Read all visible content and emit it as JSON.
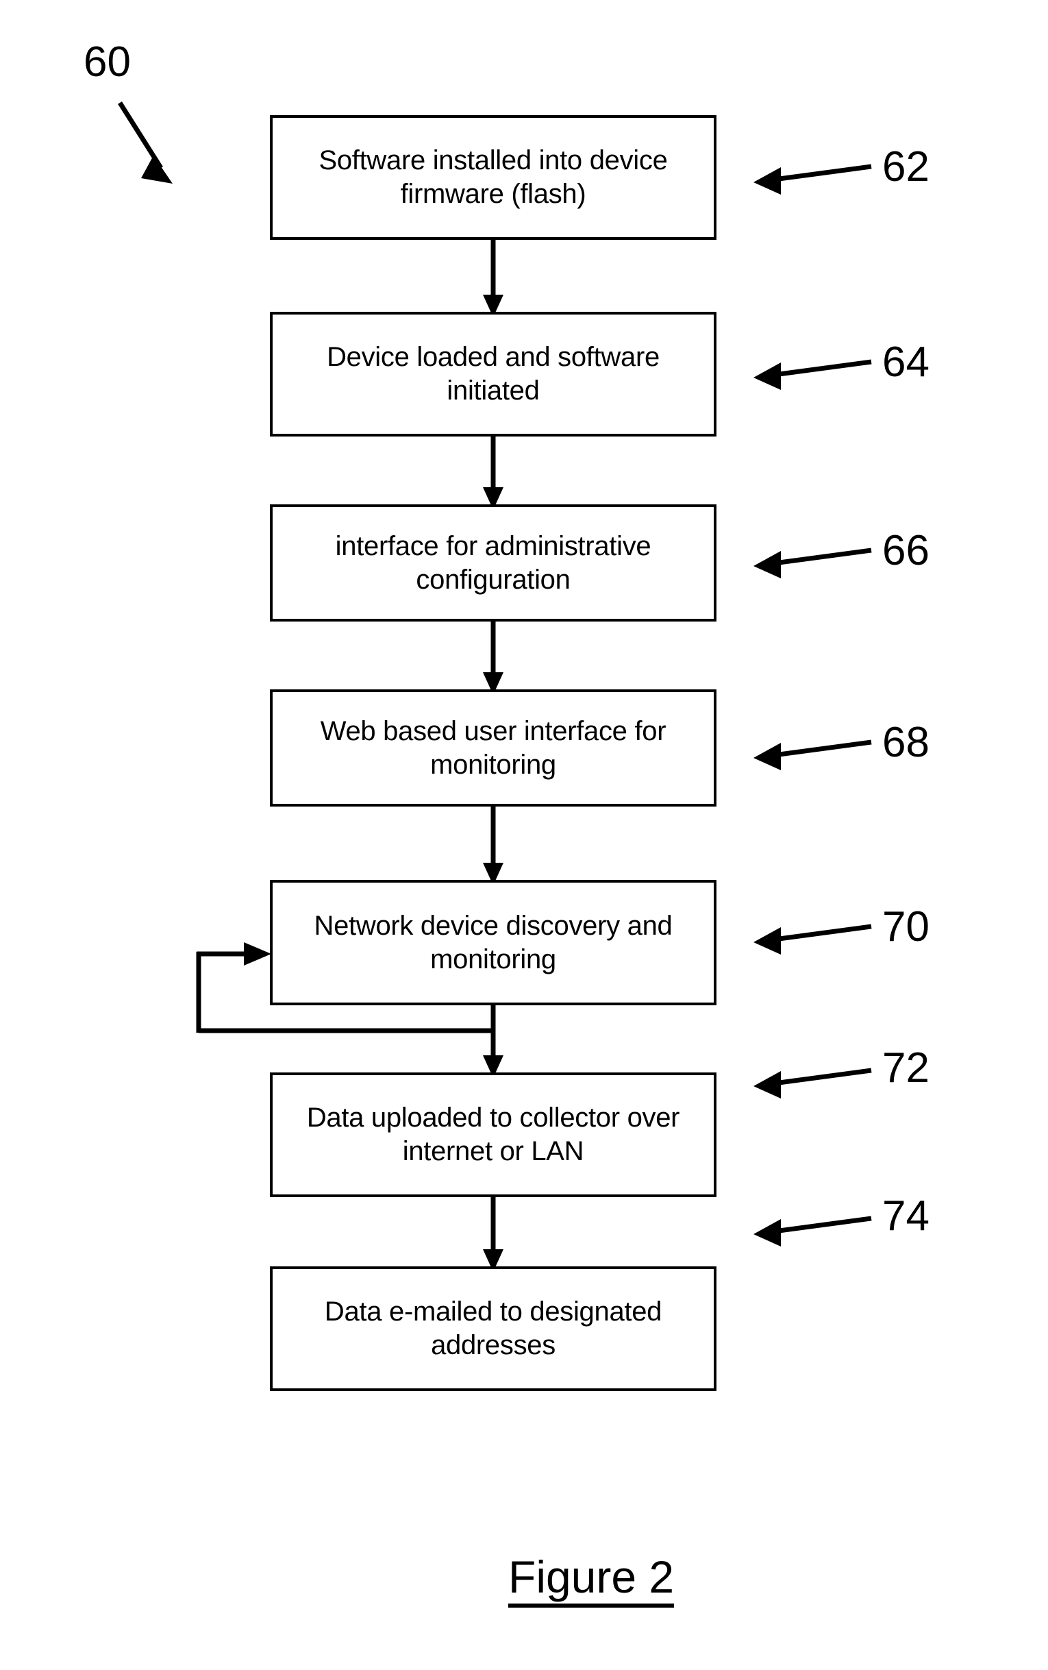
{
  "figure": {
    "caption": "Figure 2",
    "system_reference": "60"
  },
  "flowchart": {
    "type": "flowchart",
    "orientation": "top-to-bottom",
    "nodes": [
      {
        "id": "step-62",
        "ref": "62",
        "label": "Software installed into device firmware (flash)"
      },
      {
        "id": "step-64",
        "ref": "64",
        "label": "Device loaded and software initiated"
      },
      {
        "id": "step-66",
        "ref": "66",
        "label": "interface for administrative configuration"
      },
      {
        "id": "step-68",
        "ref": "68",
        "label": "Web based user interface for monitoring"
      },
      {
        "id": "step-70",
        "ref": "70",
        "label": "Network device discovery and monitoring"
      },
      {
        "id": "step-72",
        "ref": "72",
        "label": "Data uploaded to collector over internet or LAN"
      },
      {
        "id": "step-74",
        "ref": "74",
        "label": "Data e-mailed to designated addresses"
      }
    ],
    "connections": [
      {
        "from": "step-62",
        "to": "step-64",
        "kind": "arrow-down"
      },
      {
        "from": "step-64",
        "to": "step-66",
        "kind": "arrow-down"
      },
      {
        "from": "step-66",
        "to": "step-68",
        "kind": "arrow-down"
      },
      {
        "from": "step-68",
        "to": "step-70",
        "kind": "arrow-down"
      },
      {
        "from": "step-70",
        "to": "step-72",
        "kind": "arrow-down"
      },
      {
        "from": "step-72",
        "to": "step-74",
        "kind": "arrow-down"
      },
      {
        "from": "step-70",
        "to": "step-70",
        "kind": "feedback-loop-left"
      }
    ],
    "colors": {
      "line": "#000000",
      "box_fill": "#ffffff",
      "text": "#000000",
      "background": "#ffffff"
    }
  }
}
